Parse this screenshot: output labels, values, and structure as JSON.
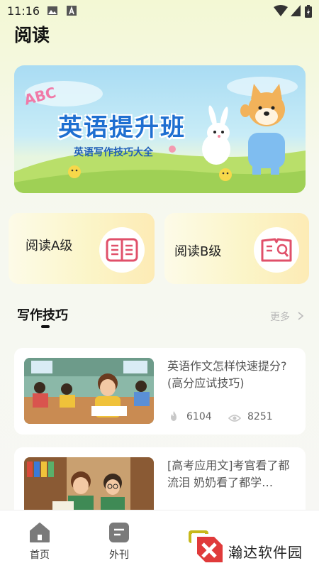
{
  "status": {
    "time": "11:16"
  },
  "page": {
    "title": "阅读"
  },
  "banner": {
    "badge": "ABC",
    "title": "英语提升班",
    "subtitle": "英语写作技巧大全"
  },
  "levels": [
    {
      "label": "阅读A级",
      "icon": "book-open-icon"
    },
    {
      "label": "阅读B级",
      "icon": "book-search-icon"
    }
  ],
  "section": {
    "title": "写作技巧",
    "more": "更多"
  },
  "articles": [
    {
      "title": "英语作文怎样快速提分? (高分应试技巧)",
      "likes": "6104",
      "views": "8251"
    },
    {
      "title": "[高考应用文]考官看了都流泪 奶奶看了都学…"
    }
  ],
  "tabs": [
    {
      "label": "首页",
      "icon": "home-icon"
    },
    {
      "label": "外刊",
      "icon": "journal-icon"
    },
    {
      "label": "",
      "icon": "reading-icon"
    },
    {
      "label": "",
      "icon": "profile-icon"
    }
  ],
  "watermark": {
    "text": "瀚达软件园"
  },
  "colors": {
    "accent": "#1f6fd1",
    "icon_red": "#e0506a",
    "card_yellow": "#fbf5c8"
  }
}
